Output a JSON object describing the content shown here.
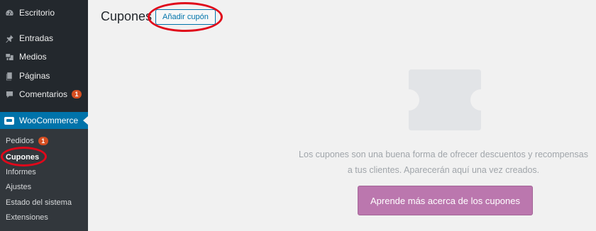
{
  "sidebar": {
    "items": [
      {
        "label": "Escritorio",
        "icon": "dashboard-icon"
      },
      {
        "label": "Entradas",
        "icon": "pushpin-icon"
      },
      {
        "label": "Medios",
        "icon": "media-icon"
      },
      {
        "label": "Páginas",
        "icon": "pages-icon"
      },
      {
        "label": "Comentarios",
        "icon": "comment-icon",
        "badge": "1"
      }
    ],
    "woocommerce": {
      "label": "WooCommerce",
      "icon": "woocommerce-icon"
    },
    "submenu": [
      {
        "label": "Pedidos",
        "badge": "1"
      },
      {
        "label": "Cupones",
        "current": true
      },
      {
        "label": "Informes"
      },
      {
        "label": "Ajustes"
      },
      {
        "label": "Estado del sistema"
      },
      {
        "label": "Extensiones"
      }
    ]
  },
  "main": {
    "title": "Cupones",
    "add_button": "Añadir cupón",
    "empty_message": "Los cupones son una buena forma de ofrecer descuentos y recompensas a tus clientes. Aparecerán aquí una vez creados.",
    "learn_more_button": "Aprende más acerca de los cupones"
  },
  "colors": {
    "sidebar_bg": "#23282d",
    "submenu_bg": "#32373c",
    "active_menu": "#0073aa",
    "badge": "#d54e21",
    "woo_purple": "#bb77ae",
    "annotation_red": "#e0081a"
  }
}
